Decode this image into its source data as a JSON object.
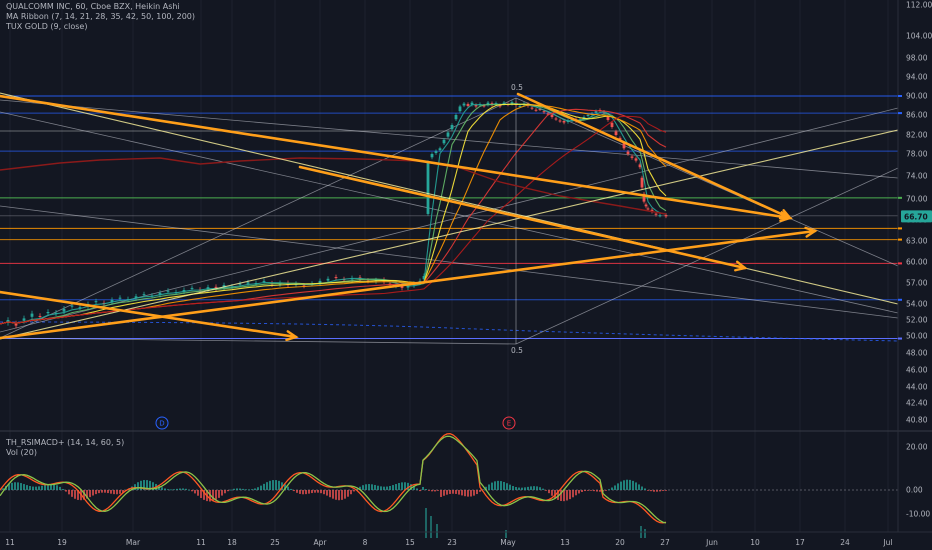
{
  "header": {
    "title": "QUALCOMM INC, 60, Cboe BZX, Heikin Ashi",
    "ribbon": "MA Ribbon (7, 14, 21, 28, 35, 42, 50, 100, 200)",
    "tux": "TUX GOLD (9, close)"
  },
  "subpanel": {
    "indicator": "TH_RSIMACD+ (14, 14, 60, 5)",
    "volume": "Vol (20)"
  },
  "chart_data": {
    "type": "line",
    "chart_style": "candlestick (Heikin Ashi) with trendlines",
    "x_labels": [
      "11",
      "19",
      "Mar",
      "11",
      "18",
      "25",
      "Apr",
      "8",
      "15",
      "23",
      "May",
      "13",
      "20",
      "27",
      "Jun",
      "10",
      "17",
      "24",
      "Jul"
    ],
    "price_ticks": [
      112.0,
      104.0,
      98.0,
      94.0,
      90.0,
      86.0,
      82.0,
      78.0,
      74.0,
      70.0,
      66.0,
      63.0,
      60.0,
      57.0,
      54.0,
      52.0,
      50.0,
      48.0,
      46.0,
      44.0,
      42.4,
      40.8
    ],
    "last_price": "66.70",
    "fib_label_top": "0.5",
    "fib_label_bottom": "0.5",
    "event_markers": [
      {
        "label": "D",
        "color": "#2962ff"
      },
      {
        "label": "E",
        "color": "#f23645"
      }
    ],
    "close_series": [
      [
        0,
        51.5
      ],
      [
        8,
        52.0
      ],
      [
        16,
        51.3
      ],
      [
        24,
        52.2
      ],
      [
        32,
        52.8
      ],
      [
        40,
        52.4
      ],
      [
        48,
        53.0
      ],
      [
        56,
        52.9
      ],
      [
        64,
        53.4
      ],
      [
        72,
        53.8
      ],
      [
        80,
        53.6
      ],
      [
        88,
        54.0
      ],
      [
        96,
        54.4
      ],
      [
        104,
        54.1
      ],
      [
        112,
        54.6
      ],
      [
        120,
        54.9
      ],
      [
        128,
        54.7
      ],
      [
        136,
        55.1
      ],
      [
        144,
        55.4
      ],
      [
        152,
        55.2
      ],
      [
        160,
        55.6
      ],
      [
        168,
        55.9
      ],
      [
        176,
        55.7
      ],
      [
        184,
        56.0
      ],
      [
        192,
        56.3
      ],
      [
        200,
        56.0
      ],
      [
        208,
        56.4
      ],
      [
        216,
        56.2
      ],
      [
        224,
        56.7
      ],
      [
        232,
        56.5
      ],
      [
        240,
        56.9
      ],
      [
        248,
        57.1
      ],
      [
        256,
        57.0
      ],
      [
        264,
        57.3
      ],
      [
        272,
        56.8
      ],
      [
        280,
        57.0
      ],
      [
        288,
        56.7
      ],
      [
        296,
        56.9
      ],
      [
        304,
        56.6
      ],
      [
        312,
        56.9
      ],
      [
        320,
        57.3
      ],
      [
        328,
        57.6
      ],
      [
        336,
        57.8
      ],
      [
        344,
        57.5
      ],
      [
        352,
        57.7
      ],
      [
        360,
        57.6
      ],
      [
        368,
        57.3
      ],
      [
        376,
        57.4
      ],
      [
        384,
        57.2
      ],
      [
        390,
        56.8
      ],
      [
        396,
        56.6
      ],
      [
        402,
        56.3
      ],
      [
        408,
        56.6
      ],
      [
        414,
        56.9
      ],
      [
        420,
        57.3
      ],
      [
        424,
        58.0
      ],
      [
        428,
        76.5
      ],
      [
        432,
        78.0
      ],
      [
        436,
        78.6
      ],
      [
        440,
        79.2
      ],
      [
        444,
        81.0
      ],
      [
        448,
        82.5
      ],
      [
        452,
        84.0
      ],
      [
        456,
        86.0
      ],
      [
        460,
        87.8
      ],
      [
        464,
        88.4
      ],
      [
        468,
        87.9
      ],
      [
        472,
        88.6
      ],
      [
        476,
        87.8
      ],
      [
        480,
        88.3
      ],
      [
        484,
        87.9
      ],
      [
        488,
        88.6
      ],
      [
        492,
        88.1
      ],
      [
        496,
        88.5
      ],
      [
        500,
        87.8
      ],
      [
        504,
        88.6
      ],
      [
        508,
        88.2
      ],
      [
        512,
        88.7
      ],
      [
        516,
        88.1
      ],
      [
        520,
        87.9
      ],
      [
        524,
        88.4
      ],
      [
        528,
        87.9
      ],
      [
        532,
        87.4
      ],
      [
        536,
        87.0
      ],
      [
        540,
        87.2
      ],
      [
        544,
        86.6
      ],
      [
        548,
        86.2
      ],
      [
        552,
        85.6
      ],
      [
        556,
        85.2
      ],
      [
        560,
        84.8
      ],
      [
        564,
        84.5
      ],
      [
        568,
        84.9
      ],
      [
        572,
        85.2
      ],
      [
        576,
        84.8
      ],
      [
        580,
        85.1
      ],
      [
        584,
        85.6
      ],
      [
        588,
        86.0
      ],
      [
        592,
        86.3
      ],
      [
        596,
        86.8
      ],
      [
        600,
        87.0
      ],
      [
        604,
        86.6
      ],
      [
        608,
        85.0
      ],
      [
        612,
        83.6
      ],
      [
        616,
        82.0
      ],
      [
        620,
        81.0
      ],
      [
        624,
        79.2
      ],
      [
        628,
        78.0
      ],
      [
        632,
        77.3
      ],
      [
        636,
        76.8
      ],
      [
        640,
        75.6
      ],
      [
        642,
        72.0
      ],
      [
        644,
        69.5
      ],
      [
        646,
        68.6
      ],
      [
        648,
        68.0
      ],
      [
        652,
        67.6
      ],
      [
        656,
        67.0
      ],
      [
        660,
        66.9
      ],
      [
        666,
        66.7
      ]
    ]
  }
}
